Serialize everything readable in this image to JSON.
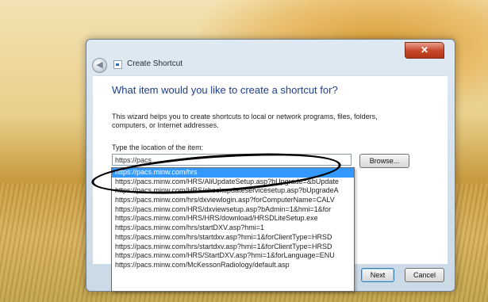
{
  "window": {
    "title": "Create Shortcut",
    "close_label": "✕",
    "back_label": "◀"
  },
  "wizard": {
    "heading": "What item would you like to create a shortcut for?",
    "description": "This wizard helps you to create shortcuts to local or network programs, files, folders, computers, or Internet addresses.",
    "location_label": "Type the location of the item:",
    "location_value": "https://pacs",
    "browse_label": "Browse...",
    "next_label": "Next",
    "cancel_label": "Cancel"
  },
  "autocomplete": {
    "items": [
      "https://pacs.minw.com/hrs",
      "https://pacs.minw.com/HRS/AliUpdateSetup.asp?bUpgrade=&bUpdate",
      "https://pacs.minw.com/HRS/checkupdateservicesetup.asp?bUpgradeA",
      "https://pacs.minw.com/hrs/dxviewlogin.asp?forComputerName=CALV",
      "https://pacs.minw.com/HRS/dxviewsetup.asp?bAdmin=1&hmi=1&for",
      "https://pacs.minw.com/HRS/HRS/download/HRSDLiteSetup.exe",
      "https://pacs.minw.com/hrs/startDXV.asp?hmi=1",
      "https://pacs.minw.com/hrs/startdxv.asp?hmi=1&forClientType=HRSD",
      "https://pacs.minw.com/hrs/startdxv.asp?hmi=1&forClientType=HRSD",
      "https://pacs.minw.com/HRS/StartDXV.asp?hmi=1&forLanguage=ENU",
      "https://pacs.minw.com/McKessonRadiology/default.asp"
    ],
    "selected_index": 0
  }
}
